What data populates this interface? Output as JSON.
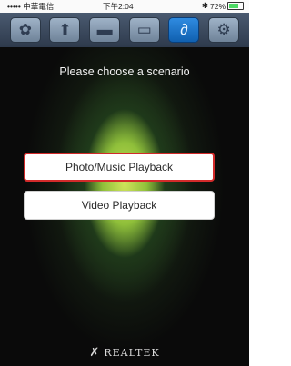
{
  "status_bar": {
    "carrier": "••••• 中華電信",
    "time": "下午2:04",
    "battery_percent": "72%",
    "icons": [
      "wifi-icon",
      "bluetooth-icon",
      "battery-icon"
    ],
    "battery_level": 0.72
  },
  "toolbar": {
    "tabs": [
      {
        "icon": "remote-control-icon",
        "glyph": "✿",
        "active": false
      },
      {
        "icon": "upload-icon",
        "glyph": "⬆",
        "active": false
      },
      {
        "icon": "screen-icon",
        "glyph": "▬",
        "active": false
      },
      {
        "icon": "folder-icon",
        "glyph": "🗁",
        "active": false
      },
      {
        "icon": "link-icon",
        "glyph": "🔗",
        "active": true
      },
      {
        "icon": "settings-icon",
        "glyph": "⚙",
        "active": false
      }
    ]
  },
  "main": {
    "title": "Please choose a scenario",
    "buttons": [
      {
        "label": "Photo/Music Playback",
        "selected": true
      },
      {
        "label": "Video Playback",
        "selected": false
      }
    ]
  },
  "footer": {
    "brand": "REALTEK"
  },
  "colors": {
    "accent_selected_border": "#d22a2a",
    "active_tab": "#1e78d0"
  }
}
